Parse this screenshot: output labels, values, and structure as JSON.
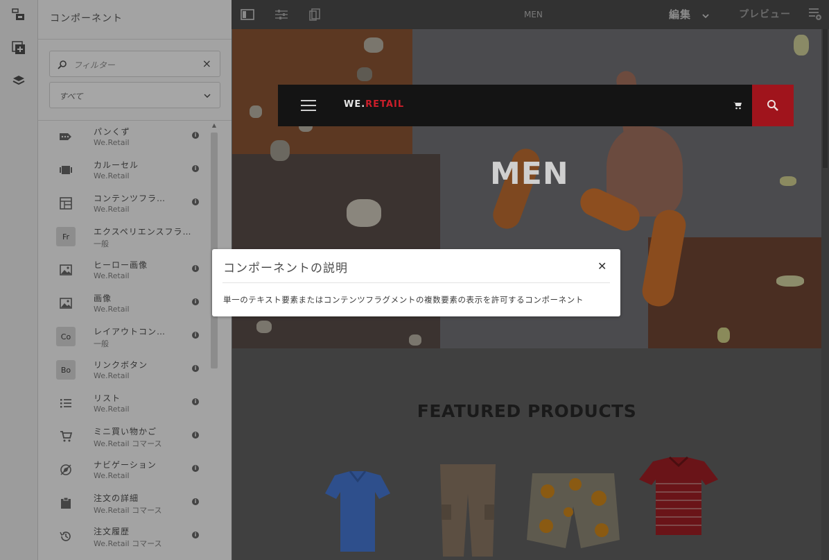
{
  "rail": {
    "icons": [
      "content-tree-icon",
      "add-component-icon",
      "layers-icon"
    ]
  },
  "panel": {
    "title": "コンポーネント",
    "filter": {
      "placeholder": "フィルター"
    },
    "group_select": {
      "value": "すべて"
    },
    "components": [
      {
        "name": "パンくず",
        "group": "We.Retail",
        "icon": "breadcrumb-icon"
      },
      {
        "name": "カルーセル",
        "group": "We.Retail",
        "icon": "carousel-icon"
      },
      {
        "name": "コンテンツフラ…",
        "group": "We.Retail",
        "icon": "content-fragment-icon"
      },
      {
        "name": "エクスペリエンスフラ…",
        "group": "一般",
        "icon": "experience-fragment-badge",
        "badge": "Fr"
      },
      {
        "name": "ヒーロー画像",
        "group": "We.Retail",
        "icon": "image-icon"
      },
      {
        "name": "画像",
        "group": "We.Retail",
        "icon": "image-icon"
      },
      {
        "name": "レイアウトコン…",
        "group": "一般",
        "icon": "layout-container-badge",
        "badge": "Co"
      },
      {
        "name": "リンクボタン",
        "group": "We.Retail",
        "icon": "link-button-badge",
        "badge": "Bo"
      },
      {
        "name": "リスト",
        "group": "We.Retail",
        "icon": "list-icon"
      },
      {
        "name": "ミニ買い物かご",
        "group": "We.Retail コマース",
        "icon": "cart-icon"
      },
      {
        "name": "ナビゲーション",
        "group": "We.Retail",
        "icon": "navigation-icon"
      },
      {
        "name": "注文の詳細",
        "group": "We.Retail コマース",
        "icon": "clipboard-icon"
      },
      {
        "name": "注文履歴",
        "group": "We.Retail コマース",
        "icon": "history-icon"
      }
    ]
  },
  "topbar": {
    "page_title": "MEN",
    "mode": "編集",
    "preview": "プレビュー"
  },
  "site": {
    "brand_we": "WE.",
    "brand_retail": "RETAIL",
    "hero_title": "MEN",
    "featured_title": "FEATURED PRODUCTS"
  },
  "dialog": {
    "title": "コンポーネントの説明",
    "body": "単一のテキスト要素またはコンテンツフラグメントの複数要素の表示を許可するコンポーネント"
  },
  "colors": {
    "brand_red": "#cc1e2a",
    "search_red": "#a0141c",
    "topbar": "#323232"
  }
}
